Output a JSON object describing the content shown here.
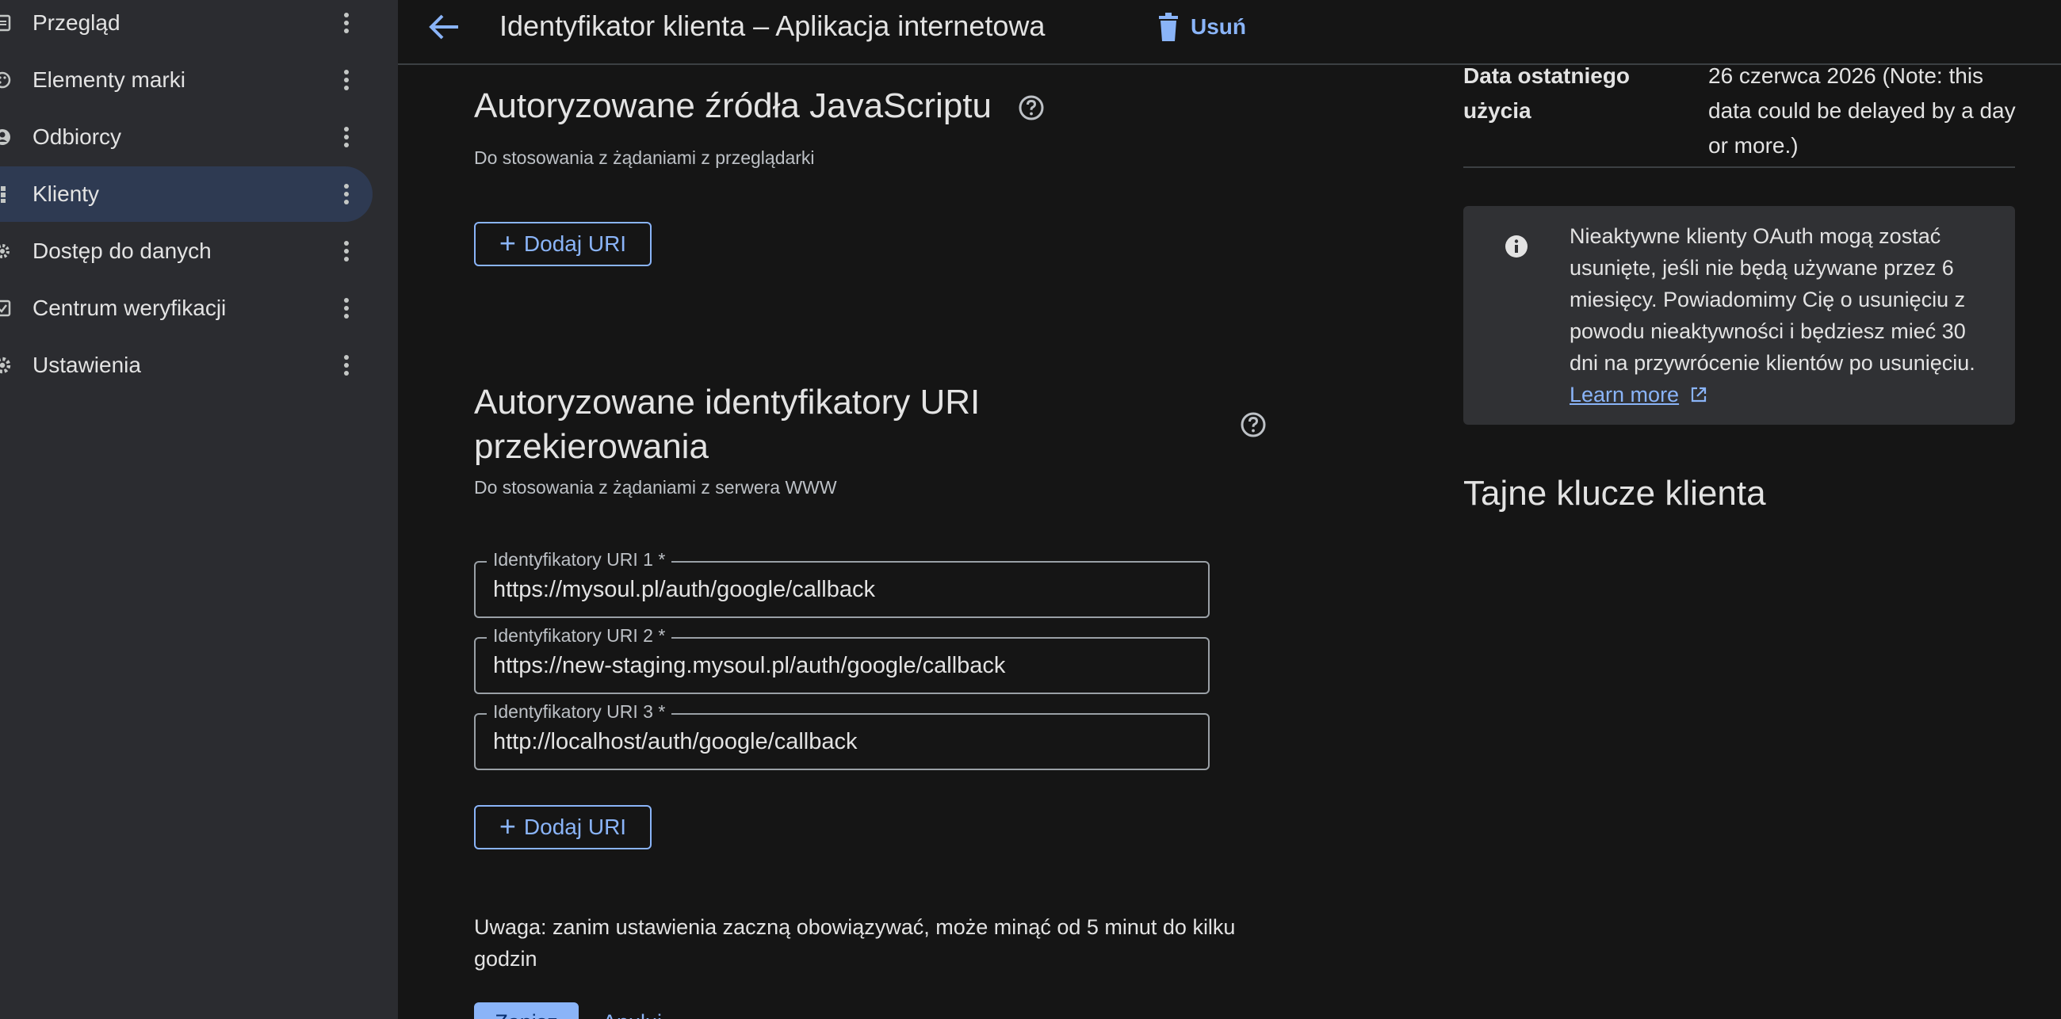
{
  "sidebar": {
    "items": [
      {
        "label": "Przegląd",
        "icon": "dashboard-icon",
        "active": false
      },
      {
        "label": "Elementy marki",
        "icon": "palette-icon",
        "active": false
      },
      {
        "label": "Odbiorcy",
        "icon": "person-icon",
        "active": false
      },
      {
        "label": "Klienty",
        "icon": "grid-icon",
        "active": true
      },
      {
        "label": "Dostęp do danych",
        "icon": "gear-icon",
        "active": false
      },
      {
        "label": "Centrum weryfikacji",
        "icon": "checkbox-icon",
        "active": false
      },
      {
        "label": "Ustawienia",
        "icon": "settings-icon",
        "active": false
      }
    ]
  },
  "header": {
    "title": "Identyfikator klienta – Aplikacja internetowa",
    "delete_label": "Usuń"
  },
  "js_origins": {
    "title": "Autoryzowane źródła JavaScriptu",
    "subtitle": "Do stosowania z żądaniami z przeglądarki",
    "add_label": "Dodaj URI"
  },
  "redirect_uris": {
    "title_line1": "Autoryzowane identyfikatory URI",
    "title_line2": "przekierowania",
    "subtitle": "Do stosowania z żądaniami z serwera WWW",
    "fields": [
      {
        "label": "Identyfikatory URI 1 *",
        "value": "https://mysoul.pl/auth/google/callback"
      },
      {
        "label": "Identyfikatory URI 2 *",
        "value": "https://new-staging.mysoul.pl/auth/google/callback"
      },
      {
        "label": "Identyfikatory URI 3 *",
        "value": "http://localhost/auth/google/callback"
      }
    ],
    "add_label": "Dodaj URI"
  },
  "note": "Uwaga: zanim ustawienia zaczną obowiązywać, może minąć od 5 minut do kilku godzin",
  "footer": {
    "save_label": "Zapisz",
    "cancel_label": "Anuluj"
  },
  "last_used": {
    "label": "Data ostatniego użycia",
    "value": "26 czerwca 2026 (Note: this data could be delayed by a day or more.)"
  },
  "info": {
    "text": "Nieaktywne klienty OAuth mogą zostać usunięte, jeśli nie będą używane przez 6 miesięcy. Powiadomimy Cię o usunięciu z powodu nieaktywności i będziesz mieć 30 dni na przywrócenie klientów po usunięciu.",
    "link": "Learn more"
  },
  "secrets": {
    "title": "Tajne klucze klienta"
  },
  "colors": {
    "accent": "#8ab4f8",
    "background": "#151515",
    "sidebar": "#2b2c30",
    "active_nav": "#2e3a52"
  }
}
